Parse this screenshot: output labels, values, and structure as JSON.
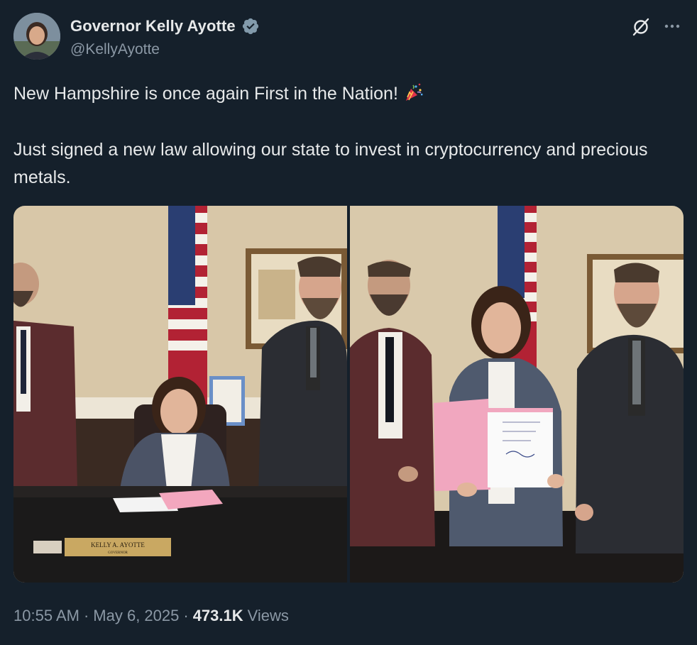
{
  "author": {
    "display_name": "Governor Kelly Ayotte",
    "handle": "@KellyAyotte",
    "verified_icon": "verified-badge-icon",
    "badge_color": "#829aab"
  },
  "post": {
    "line1": "New Hampshire is once again First in the Nation!",
    "line1_emoji": "party-popper-icon",
    "line2": "Just signed a new law allowing our state to invest in cryptocurrency and precious metals."
  },
  "media": {
    "photo_count": 2,
    "nameplate_text": "KELLY A. AYOTTE",
    "nameplate_subtitle": "GOVERNOR"
  },
  "meta": {
    "time": "10:55 AM",
    "separator": "·",
    "date": "May 6, 2025",
    "views_count": "473.1K",
    "views_label": "Views"
  },
  "colors": {
    "background": "#15202b",
    "text_primary": "#e7e9ea",
    "text_secondary": "#8b98a5"
  }
}
